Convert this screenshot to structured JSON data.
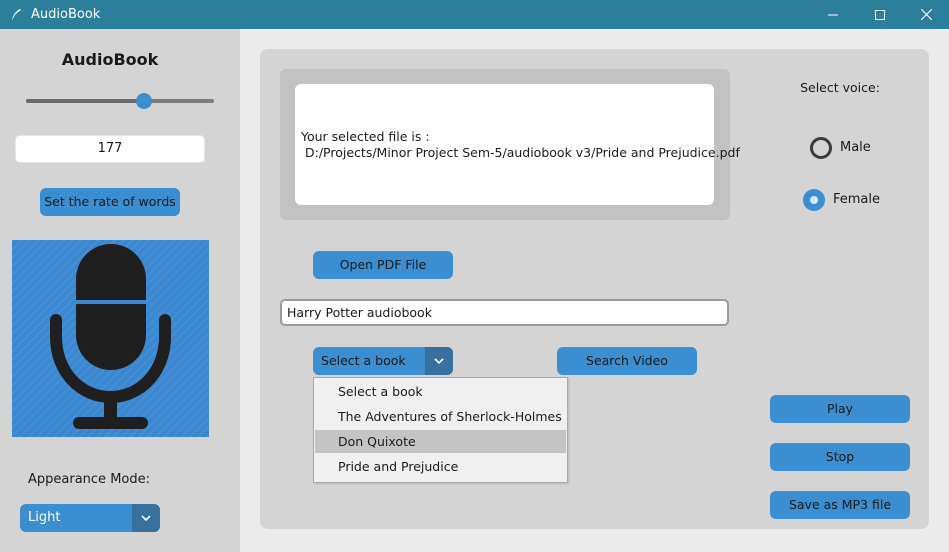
{
  "window": {
    "title": "AudioBook",
    "controls": {
      "minimize": "—",
      "maximize": "☐",
      "close": "✕"
    }
  },
  "sidebar": {
    "title": "AudioBook",
    "rate_slider": {
      "value_fraction": 0.63
    },
    "rate_value": "177",
    "rate_button": "Set the rate of words",
    "image_icon": "microphone-icon",
    "appearance_label": "Appearance Mode:",
    "appearance_value": "Light"
  },
  "main": {
    "file_label": "Your selected file is :",
    "file_path": "D:/Projects/Minor Project Sem-5/audiobook v3/Pride and Prejudice.pdf",
    "open_pdf_button": "Open PDF File",
    "search_entry_value": "Harry Potter audiobook",
    "book_menu_value": "Select a book",
    "search_video_button": "Search Video",
    "book_options": [
      {
        "label": "Select a book",
        "highlighted": false
      },
      {
        "label": "The Adventures of Sherlock-Holmes",
        "highlighted": false
      },
      {
        "label": "Don Quixote",
        "highlighted": true
      },
      {
        "label": "Pride and Prejudice",
        "highlighted": false
      }
    ]
  },
  "voice": {
    "label": "Select voice:",
    "options": [
      {
        "label": "Male",
        "selected": false
      },
      {
        "label": "Female",
        "selected": true
      }
    ]
  },
  "actions": {
    "play": "Play",
    "stop": "Stop",
    "save": "Save as MP3 file"
  },
  "colors": {
    "titlebar": "#2c7f9b",
    "accent": "#3b8ed0",
    "accent_dark": "#36719f",
    "panel": "#d4d4d4"
  }
}
